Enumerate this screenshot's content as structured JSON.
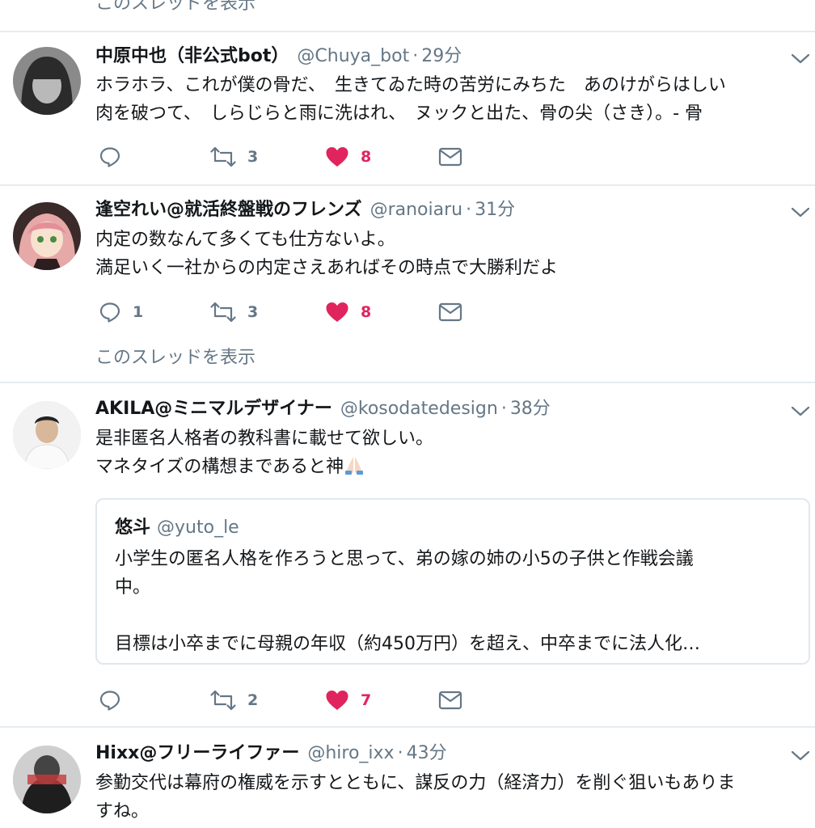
{
  "top": {
    "show_thread": "このスレッドを表示"
  },
  "tweets": [
    {
      "name": "中原中也（非公式bot）",
      "handle": "@Chuya_bot",
      "separator": "·",
      "time": "29分",
      "lines": [
        "ホラホラ、これが僕の骨だ、　生きてゐた時の苦労にみちた　あのけがらはしい",
        "肉を破つて、　しらじらと雨に洗はれ、　ヌックと出た、骨の尖（さき）。- 骨"
      ],
      "reply_count": "",
      "retweet_count": "3",
      "like_count": "8"
    },
    {
      "name": "逢空れい@就活終盤戦のフレンズ",
      "handle": "@ranoiaru",
      "separator": "·",
      "time": "31分",
      "lines": [
        "内定の数なんて多くても仕方ないよ。",
        "満足いく一社からの内定さえあればその時点で大勝利だよ"
      ],
      "reply_count": "1",
      "retweet_count": "3",
      "like_count": "8",
      "show_thread": "このスレッドを表示"
    },
    {
      "name": "AKILA@ミニマルデザイナー",
      "handle": "@kosodatedesign",
      "separator": "·",
      "time": "38分",
      "lines": [
        "是非匿名人格者の教科書に載せて欲しい。",
        "マネタイズの構想まであると神"
      ],
      "emoji": "folded-hands-emoji",
      "quote": {
        "name": "悠斗",
        "handle": "@yuto_le",
        "lines": [
          "小学生の匿名人格を作ろうと思って、弟の嫁の姉の小5の子供と作戦会議",
          "中。",
          "",
          "目標は小卒までに母親の年収（約450万円）を超え、中卒までに法人化…"
        ]
      },
      "reply_count": "",
      "retweet_count": "2",
      "like_count": "7"
    },
    {
      "name": "Hixx@フリーライファー",
      "handle": "@hiro_ixx",
      "separator": "·",
      "time": "43分",
      "lines": [
        "参勤交代は幕府の権威を示すとともに、謀反の力（経済力）を削ぐ狙いもありま",
        "すね。"
      ]
    }
  ],
  "colors": {
    "text": "#14171a",
    "muted": "#657786",
    "like": "#e0245e",
    "divider": "#e6ecf0"
  }
}
